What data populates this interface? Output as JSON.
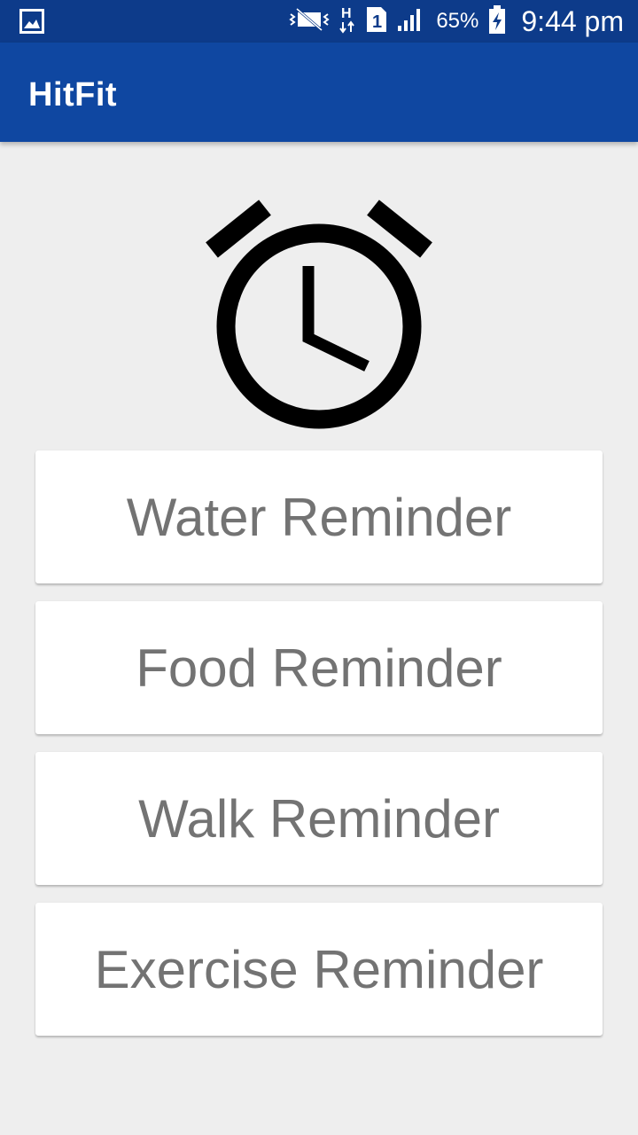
{
  "status_bar": {
    "battery_percent": "65%",
    "time": "9:44 pm",
    "icons": [
      "gallery-notification-icon",
      "vibrate-mute-icon",
      "hspa-data-icon",
      "sim-1-icon",
      "signal-strength-icon",
      "battery-charging-icon"
    ],
    "background": "#0d3b8a"
  },
  "app_bar": {
    "title": "HitFit",
    "background": "#0f47a1"
  },
  "hero": {
    "icon": "alarm-clock-icon"
  },
  "reminders": [
    {
      "label": "Water Reminder"
    },
    {
      "label": "Food Reminder"
    },
    {
      "label": "Walk Reminder"
    },
    {
      "label": "Exercise Reminder"
    }
  ]
}
